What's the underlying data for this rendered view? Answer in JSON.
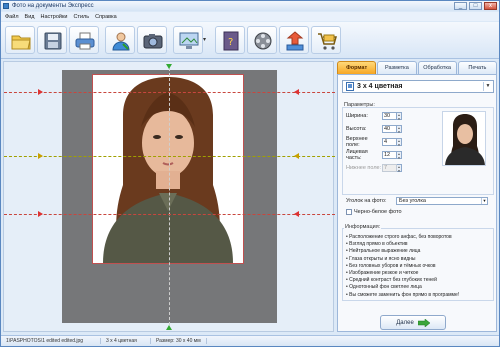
{
  "window": {
    "title": "Фото на документы Экспресс",
    "minimize": "_",
    "maximize": "□",
    "close": "x"
  },
  "menu": [
    "Файл",
    "Вид",
    "Настройки",
    "Стиль",
    "Справка"
  ],
  "toolbar": {
    "buttons": [
      "open-folder-icon",
      "save-disk-icon",
      "print-icon",
      "user-icon",
      "camera-icon",
      "monitor-icon",
      "help-book-icon",
      "film-reel-icon",
      "export-icon",
      "cart-icon"
    ],
    "dropdown_arrow": "▾"
  },
  "tabs": [
    "Формат",
    "Разметка",
    "Обработка",
    "Печать"
  ],
  "format": {
    "selected": "3 x 4 цветная"
  },
  "params": {
    "label": "Параметры:",
    "width_label": "Ширина:",
    "width_value": "30",
    "height_label": "Высота:",
    "height_value": "40",
    "top_margin_label": "Верхнее поле:",
    "top_margin_value": "4",
    "face_label": "Лицевая часть:",
    "face_value": "12",
    "bottom_margin_label": "Нижнее поле:",
    "bottom_margin_value": "7"
  },
  "corner": {
    "label": "Уголок на фото:",
    "value": "Без уголка"
  },
  "bw": {
    "label": "Черно-белое фото",
    "checked": false
  },
  "info": {
    "title": "Информация:",
    "items": [
      "Расположение строго анфас, без поворотов",
      "Взгляд прямо в объектив",
      "Нейтральное выражение лица",
      "Глаза открыты и ясно видны",
      "Без головных уборов и тёмных очков",
      "Изображение резкое и четкое",
      "Средний контраст без глубоких теней",
      "Однотонный фон светлее лица",
      "Вы сможете заменить фон прямо в программе!"
    ]
  },
  "next_button": "Далее",
  "status": {
    "path": "1\\PASPHOTOS\\1 edited edited.jpg",
    "format": "3 x 4 цветная",
    "size": "Размер: 30 x 40 мм"
  },
  "colors": {
    "active_tab": "#f6a623",
    "guide_red": "#c8463e",
    "marker_green": "#33aa33"
  }
}
